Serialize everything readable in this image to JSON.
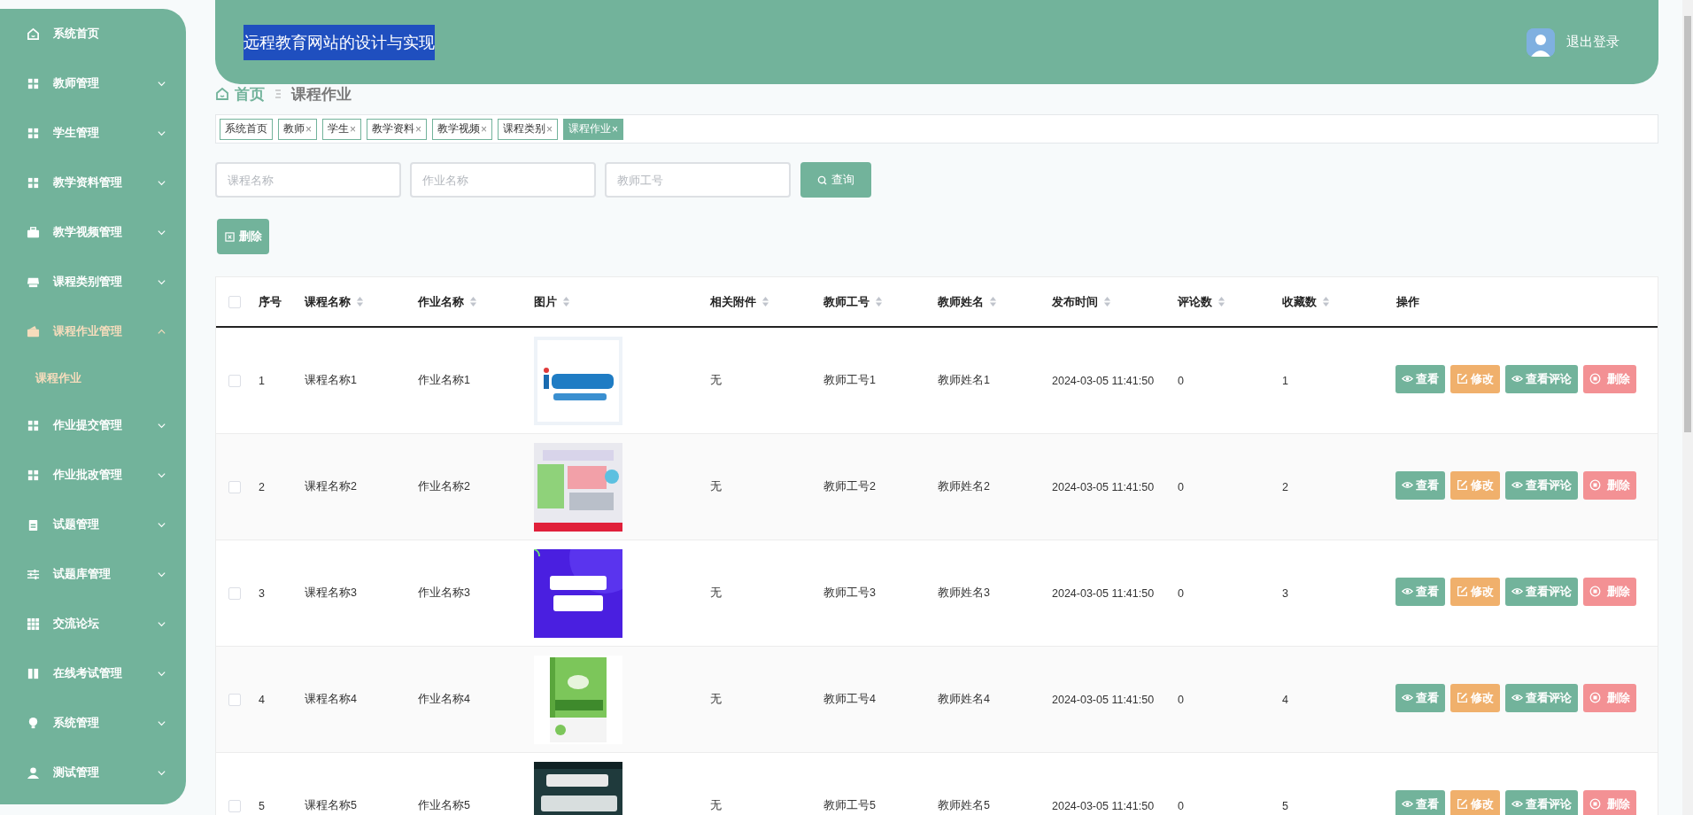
{
  "sidebar": {
    "items": [
      {
        "label": "系统首页",
        "kind": "link",
        "expanded": false
      },
      {
        "label": "教师管理",
        "kind": "menu",
        "expanded": false
      },
      {
        "label": "学生管理",
        "kind": "menu",
        "expanded": false
      },
      {
        "label": "教学资料管理",
        "kind": "menu",
        "expanded": false
      },
      {
        "label": "教学视频管理",
        "kind": "menu",
        "expanded": false
      },
      {
        "label": "课程类别管理",
        "kind": "menu",
        "expanded": false
      },
      {
        "label": "课程作业管理",
        "kind": "menu",
        "expanded": true,
        "children": [
          {
            "label": "课程作业",
            "selected": true
          }
        ]
      },
      {
        "label": "作业提交管理",
        "kind": "menu",
        "expanded": false
      },
      {
        "label": "作业批改管理",
        "kind": "menu",
        "expanded": false
      },
      {
        "label": "试题管理",
        "kind": "menu",
        "expanded": false
      },
      {
        "label": "试题库管理",
        "kind": "menu",
        "expanded": false
      },
      {
        "label": "交流论坛",
        "kind": "menu",
        "expanded": false
      },
      {
        "label": "在线考试管理",
        "kind": "menu",
        "expanded": false
      },
      {
        "label": "系统管理",
        "kind": "menu",
        "expanded": false
      },
      {
        "label": "测试管理",
        "kind": "menu",
        "expanded": false
      }
    ]
  },
  "header": {
    "title": {
      "text": "远程教育网站的设计与实现",
      "highlighted": true
    },
    "logout": "退出登录"
  },
  "breadcrumb": {
    "home": "首页",
    "current": "课程作业"
  },
  "tags": [
    {
      "label": "系统首页",
      "selected": false
    },
    {
      "label": "教师",
      "close": "×",
      "selected": false
    },
    {
      "label": "学生",
      "close": "×",
      "selected": false
    },
    {
      "label": "教学资料",
      "close": "×",
      "selected": false
    },
    {
      "label": "教学视频",
      "close": "×",
      "selected": false
    },
    {
      "label": "课程类别",
      "close": "×",
      "selected": false
    },
    {
      "label": "课程作业",
      "close": "×",
      "selected": true
    }
  ],
  "search": {
    "fields": [
      {
        "placeholder": "课程名称"
      },
      {
        "placeholder": "作业名称"
      },
      {
        "placeholder": "教师工号"
      }
    ],
    "button": "查询"
  },
  "delete_button": "删除",
  "table": {
    "select_all": {
      "checked": false
    },
    "columns": [
      {
        "label": "序号",
        "sortable": false
      },
      {
        "label": "课程名称",
        "sortable": true
      },
      {
        "label": "作业名称",
        "sortable": true
      },
      {
        "label": "图片",
        "sortable": true
      },
      {
        "label": "相关附件",
        "sortable": true
      },
      {
        "label": "教师工号",
        "sortable": true
      },
      {
        "label": "教师姓名",
        "sortable": true
      },
      {
        "label": "发布时间",
        "sortable": true
      },
      {
        "label": "评论数",
        "sortable": true
      },
      {
        "label": "收藏数",
        "sortable": true
      },
      {
        "label": "操作",
        "sortable": false
      }
    ],
    "rows": [
      {
        "checked": false,
        "index": "1",
        "course": "课程名称1",
        "homework": "作业名称1",
        "image": {
          "kind": "picture"
        },
        "attachment": "无",
        "teacher_id": "教师工号1",
        "teacher_name": "教师姓名1",
        "time": "2024-03-05 11:41:50",
        "comments": "0",
        "favorites": "1",
        "actions": [
          {
            "kind": "view",
            "label": "查看"
          },
          {
            "kind": "edit",
            "label": "修改"
          },
          {
            "kind": "comments",
            "label": "查看评论"
          },
          {
            "kind": "delete",
            "label": "删除"
          }
        ]
      },
      {
        "checked": false,
        "index": "2",
        "course": "课程名称2",
        "homework": "作业名称2",
        "image": {
          "kind": "picture"
        },
        "attachment": "无",
        "teacher_id": "教师工号2",
        "teacher_name": "教师姓名2",
        "time": "2024-03-05 11:41:50",
        "comments": "0",
        "favorites": "2",
        "actions": [
          {
            "kind": "view",
            "label": "查看"
          },
          {
            "kind": "edit",
            "label": "修改"
          },
          {
            "kind": "comments",
            "label": "查看评论"
          },
          {
            "kind": "delete",
            "label": "删除"
          }
        ]
      },
      {
        "checked": false,
        "index": "3",
        "course": "课程名称3",
        "homework": "作业名称3",
        "image": {
          "kind": "picture"
        },
        "attachment": "无",
        "teacher_id": "教师工号3",
        "teacher_name": "教师姓名3",
        "time": "2024-03-05 11:41:50",
        "comments": "0",
        "favorites": "3",
        "actions": [
          {
            "kind": "view",
            "label": "查看"
          },
          {
            "kind": "edit",
            "label": "修改"
          },
          {
            "kind": "comments",
            "label": "查看评论"
          },
          {
            "kind": "delete",
            "label": "删除"
          }
        ]
      },
      {
        "checked": false,
        "index": "4",
        "course": "课程名称4",
        "homework": "作业名称4",
        "image": {
          "kind": "picture"
        },
        "attachment": "无",
        "teacher_id": "教师工号4",
        "teacher_name": "教师姓名4",
        "time": "2024-03-05 11:41:50",
        "comments": "0",
        "favorites": "4",
        "actions": [
          {
            "kind": "view",
            "label": "查看"
          },
          {
            "kind": "edit",
            "label": "修改"
          },
          {
            "kind": "comments",
            "label": "查看评论"
          },
          {
            "kind": "delete",
            "label": "删除"
          }
        ]
      },
      {
        "checked": false,
        "index": "5",
        "course": "课程名称5",
        "homework": "作业名称5",
        "image": {
          "kind": "picture"
        },
        "attachment": "无",
        "teacher_id": "教师工号5",
        "teacher_name": "教师姓名5",
        "time": "2024-03-05 11:41:50",
        "comments": "0",
        "favorites": "5",
        "actions": [
          {
            "kind": "view",
            "label": "查看"
          },
          {
            "kind": "edit",
            "label": "修改"
          },
          {
            "kind": "comments",
            "label": "查看评论"
          },
          {
            "kind": "delete",
            "label": "删除"
          }
        ]
      }
    ]
  }
}
